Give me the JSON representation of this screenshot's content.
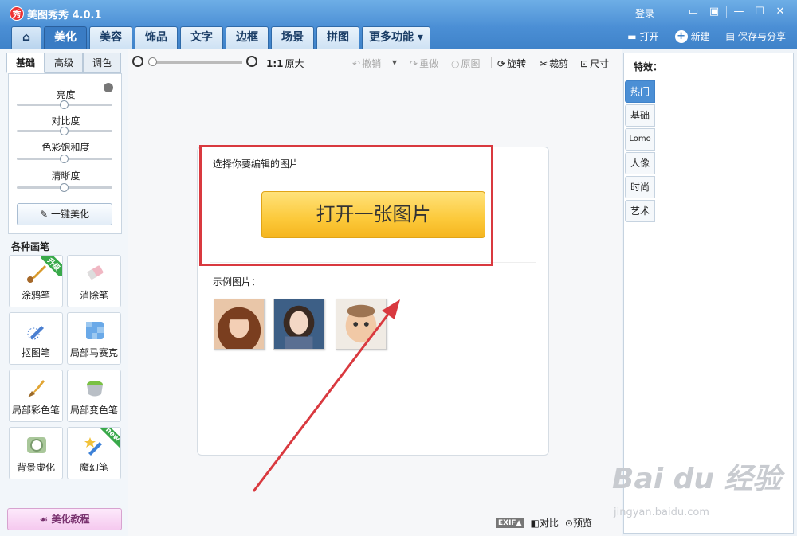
{
  "app": {
    "logo": "秀",
    "title": "美图秀秀 4.0.1",
    "login": "登录"
  },
  "window_controls": [
    "message-icon",
    "skin-icon",
    "minimize-icon",
    "maximize-icon",
    "close-icon"
  ],
  "main_tabs": [
    {
      "label": "美化",
      "active": true
    },
    {
      "label": "美容"
    },
    {
      "label": "饰品"
    },
    {
      "label": "文字"
    },
    {
      "label": "边框"
    },
    {
      "label": "场景"
    },
    {
      "label": "拼图"
    },
    {
      "label": "更多功能 ▾"
    }
  ],
  "top_actions": {
    "open": "打开",
    "new": "新建",
    "save": "保存与分享"
  },
  "sub_tabs": [
    "基础",
    "高级",
    "调色"
  ],
  "adjust": {
    "brightness": "亮度",
    "contrast": "对比度",
    "saturation": "色彩饱和度",
    "sharpness": "清晰度",
    "one_key": "一键美化"
  },
  "brushes": {
    "title": "各种画笔",
    "items": [
      {
        "label": "涂鸦笔",
        "badge": "升级"
      },
      {
        "label": "消除笔"
      },
      {
        "label": "抠图笔"
      },
      {
        "label": "局部马赛克"
      },
      {
        "label": "局部彩色笔"
      },
      {
        "label": "局部变色笔"
      },
      {
        "label": "背景虚化"
      },
      {
        "label": "魔幻笔",
        "badge": "new"
      }
    ]
  },
  "tutorial": "美化教程",
  "toolbar": {
    "ratio": "1:1",
    "original_size": "原大",
    "undo": "撤销",
    "redo": "重做",
    "origin": "原图",
    "rotate": "旋转",
    "crop": "裁剪",
    "size": "尺寸"
  },
  "card": {
    "title": "选择你要编辑的图片",
    "open_button": "打开一张图片",
    "samples_title": "示例图片："
  },
  "bottom": {
    "exif": "EXIF▲",
    "compare": "对比",
    "preview": "预览"
  },
  "effects": {
    "title": "特效：",
    "tabs": [
      "热门",
      "基础",
      "Lomo",
      "人像",
      "时尚",
      "艺术"
    ]
  },
  "watermark": {
    "brand": "Bai du 经验",
    "url": "jingyan.baidu.com"
  },
  "colors": {
    "titlebar": "#4b8fd5",
    "accent_button": "#fcc93a",
    "annotation": "#d9393f"
  }
}
